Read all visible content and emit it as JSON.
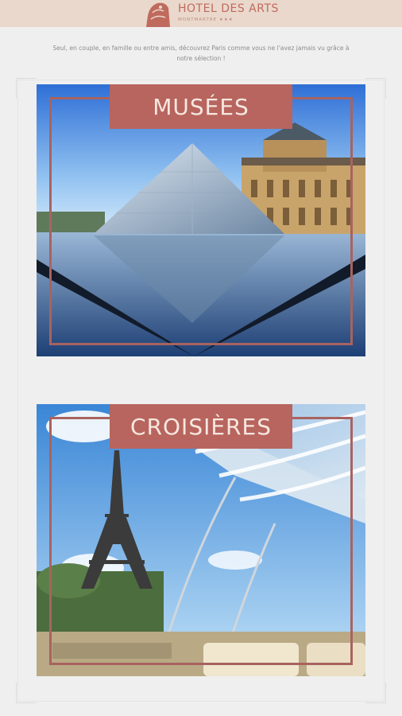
{
  "header": {
    "logo_title": "HOTEL DES ARTS",
    "logo_subtitle": "MONTMARTRE ★★★",
    "background": "#ead8cc",
    "accent": "#c06a5e"
  },
  "intro": {
    "text": "Seul, en couple, en famille ou entre amis, découvrez Paris comme vous ne l'avez jamais vu grâce à notre sélection !"
  },
  "cards": [
    {
      "title": "MUSÉES",
      "image": "louvre-pyramid"
    },
    {
      "title": "CROISIÈRES",
      "image": "eiffel-tower-boat"
    }
  ],
  "colors": {
    "banner": "#b7655e",
    "banner_text": "#f7e7e0",
    "frame": "#a86360",
    "page_bg": "#efefef"
  }
}
